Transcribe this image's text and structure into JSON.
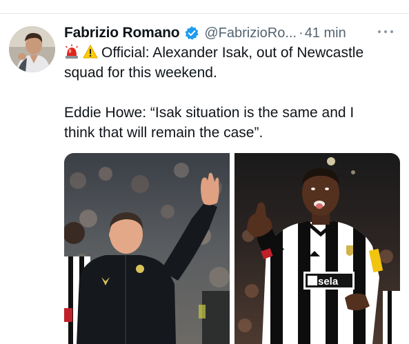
{
  "tweet": {
    "author": {
      "display_name": "Fabrizio Romano",
      "handle": "@FabrizioRo...",
      "verified": true,
      "avatar_icon": "avatar-photo"
    },
    "separator": "·",
    "time": "41 min",
    "more_icon": "more-dots-icon",
    "text": {
      "emoji_1": "rotating-light-emoji",
      "emoji_2": "warning-emoji",
      "line_1": "Official: Alexander Isak, out of Newcastle",
      "line_2": "squad for this weekend.",
      "line_3": "Eddie Howe: “Isak situation is the same and I",
      "line_4": "think that will remain the case”."
    },
    "media": {
      "count": 2,
      "right_photo_shirt_text": "sela"
    },
    "colors": {
      "verified": "#1d9bf0",
      "muted": "#536471",
      "text": "#0f1419",
      "divider": "#e6e9ec"
    }
  }
}
